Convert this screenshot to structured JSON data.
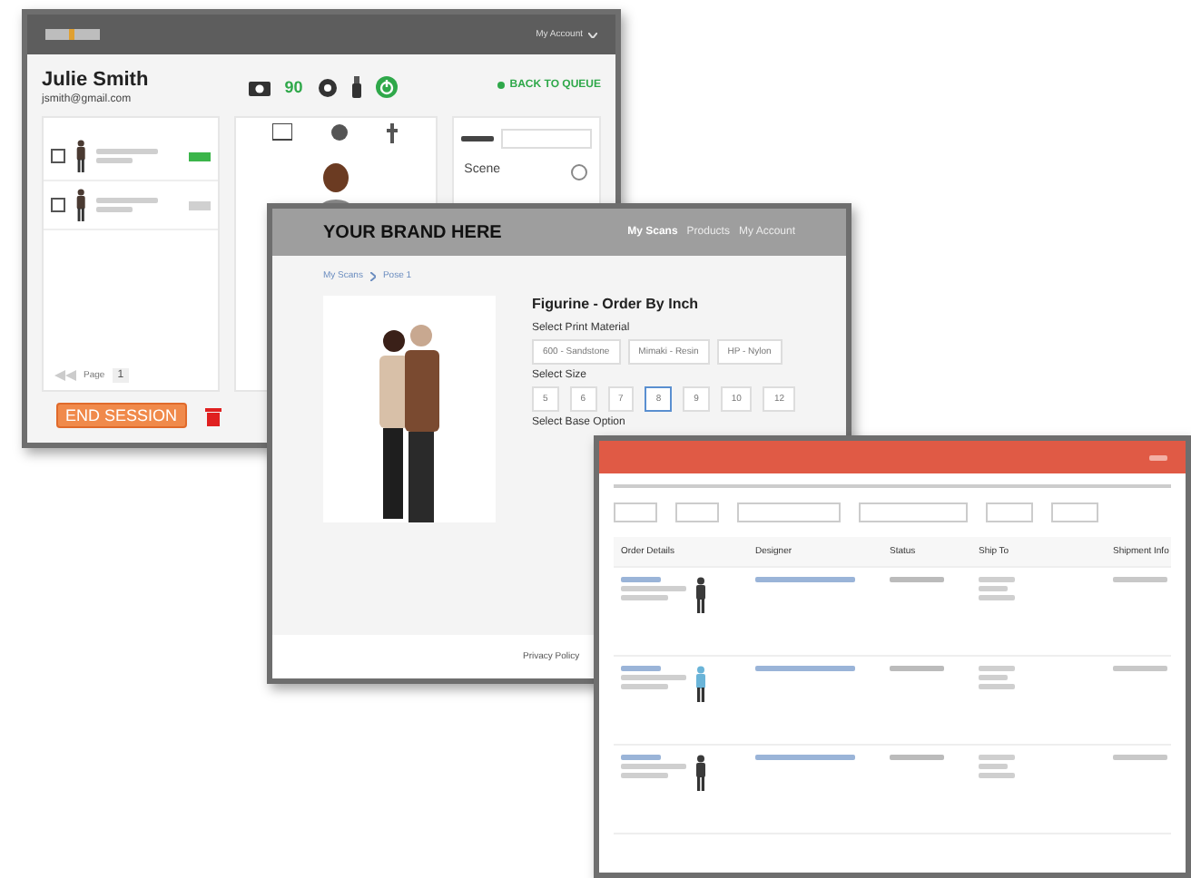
{
  "scanner_window": {
    "account_menu": "My Account",
    "customer": {
      "name": "Julie Smith",
      "email": "jsmith@gmail.com"
    },
    "photo_count": "90",
    "back_link": "BACK TO QUEUE",
    "scans": [
      {
        "checked": false,
        "color": "#3bb54a"
      },
      {
        "checked": false,
        "color": "#d0d0d0"
      }
    ],
    "scene_label": "Scene",
    "page_label": "Page",
    "page_value": "1",
    "end_button": "END SESSION"
  },
  "store_window": {
    "brand": "YOUR BRAND HERE",
    "nav": [
      {
        "label": "My Scans",
        "selected": true
      },
      {
        "label": "Products",
        "selected": false
      },
      {
        "label": "My Account",
        "selected": false
      }
    ],
    "breadcrumb": [
      "My Scans",
      "Pose 1"
    ],
    "product_title": "Figurine - Order By Inch",
    "material_label": "Select Print Material",
    "materials": [
      "600 - Sandstone",
      "Mimaki - Resin",
      "HP - Nylon"
    ],
    "size_label": "Select Size",
    "sizes": [
      {
        "label": "5",
        "selected": false
      },
      {
        "label": "6",
        "selected": false
      },
      {
        "label": "7",
        "selected": false
      },
      {
        "label": "8",
        "selected": true
      },
      {
        "label": "9",
        "selected": false
      },
      {
        "label": "10",
        "selected": false
      },
      {
        "label": "12",
        "selected": false
      }
    ],
    "base_label": "Select Base Option",
    "footer_link": "Privacy Policy"
  },
  "admin_window": {
    "columns": [
      "Order Details",
      "Designer",
      "Status",
      "Ship To",
      "Shipment Info"
    ]
  }
}
